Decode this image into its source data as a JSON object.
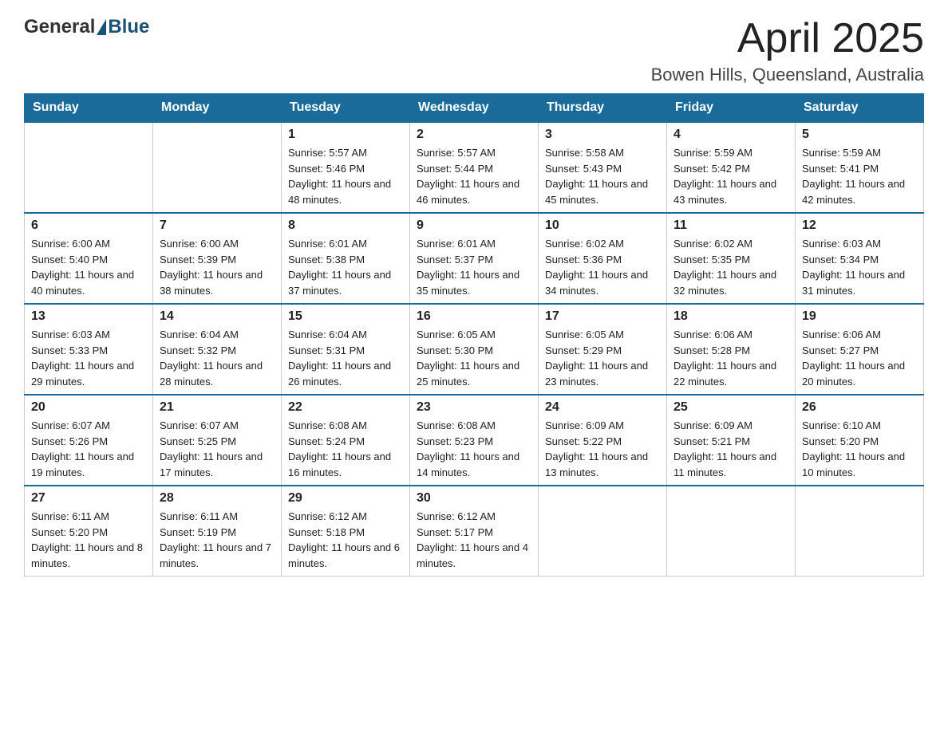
{
  "header": {
    "logo_general": "General",
    "logo_blue": "Blue",
    "month_title": "April 2025",
    "location": "Bowen Hills, Queensland, Australia"
  },
  "weekdays": [
    "Sunday",
    "Monday",
    "Tuesday",
    "Wednesday",
    "Thursday",
    "Friday",
    "Saturday"
  ],
  "weeks": [
    [
      {
        "day": "",
        "sunrise": "",
        "sunset": "",
        "daylight": ""
      },
      {
        "day": "",
        "sunrise": "",
        "sunset": "",
        "daylight": ""
      },
      {
        "day": "1",
        "sunrise": "Sunrise: 5:57 AM",
        "sunset": "Sunset: 5:46 PM",
        "daylight": "Daylight: 11 hours and 48 minutes."
      },
      {
        "day": "2",
        "sunrise": "Sunrise: 5:57 AM",
        "sunset": "Sunset: 5:44 PM",
        "daylight": "Daylight: 11 hours and 46 minutes."
      },
      {
        "day": "3",
        "sunrise": "Sunrise: 5:58 AM",
        "sunset": "Sunset: 5:43 PM",
        "daylight": "Daylight: 11 hours and 45 minutes."
      },
      {
        "day": "4",
        "sunrise": "Sunrise: 5:59 AM",
        "sunset": "Sunset: 5:42 PM",
        "daylight": "Daylight: 11 hours and 43 minutes."
      },
      {
        "day": "5",
        "sunrise": "Sunrise: 5:59 AM",
        "sunset": "Sunset: 5:41 PM",
        "daylight": "Daylight: 11 hours and 42 minutes."
      }
    ],
    [
      {
        "day": "6",
        "sunrise": "Sunrise: 6:00 AM",
        "sunset": "Sunset: 5:40 PM",
        "daylight": "Daylight: 11 hours and 40 minutes."
      },
      {
        "day": "7",
        "sunrise": "Sunrise: 6:00 AM",
        "sunset": "Sunset: 5:39 PM",
        "daylight": "Daylight: 11 hours and 38 minutes."
      },
      {
        "day": "8",
        "sunrise": "Sunrise: 6:01 AM",
        "sunset": "Sunset: 5:38 PM",
        "daylight": "Daylight: 11 hours and 37 minutes."
      },
      {
        "day": "9",
        "sunrise": "Sunrise: 6:01 AM",
        "sunset": "Sunset: 5:37 PM",
        "daylight": "Daylight: 11 hours and 35 minutes."
      },
      {
        "day": "10",
        "sunrise": "Sunrise: 6:02 AM",
        "sunset": "Sunset: 5:36 PM",
        "daylight": "Daylight: 11 hours and 34 minutes."
      },
      {
        "day": "11",
        "sunrise": "Sunrise: 6:02 AM",
        "sunset": "Sunset: 5:35 PM",
        "daylight": "Daylight: 11 hours and 32 minutes."
      },
      {
        "day": "12",
        "sunrise": "Sunrise: 6:03 AM",
        "sunset": "Sunset: 5:34 PM",
        "daylight": "Daylight: 11 hours and 31 minutes."
      }
    ],
    [
      {
        "day": "13",
        "sunrise": "Sunrise: 6:03 AM",
        "sunset": "Sunset: 5:33 PM",
        "daylight": "Daylight: 11 hours and 29 minutes."
      },
      {
        "day": "14",
        "sunrise": "Sunrise: 6:04 AM",
        "sunset": "Sunset: 5:32 PM",
        "daylight": "Daylight: 11 hours and 28 minutes."
      },
      {
        "day": "15",
        "sunrise": "Sunrise: 6:04 AM",
        "sunset": "Sunset: 5:31 PM",
        "daylight": "Daylight: 11 hours and 26 minutes."
      },
      {
        "day": "16",
        "sunrise": "Sunrise: 6:05 AM",
        "sunset": "Sunset: 5:30 PM",
        "daylight": "Daylight: 11 hours and 25 minutes."
      },
      {
        "day": "17",
        "sunrise": "Sunrise: 6:05 AM",
        "sunset": "Sunset: 5:29 PM",
        "daylight": "Daylight: 11 hours and 23 minutes."
      },
      {
        "day": "18",
        "sunrise": "Sunrise: 6:06 AM",
        "sunset": "Sunset: 5:28 PM",
        "daylight": "Daylight: 11 hours and 22 minutes."
      },
      {
        "day": "19",
        "sunrise": "Sunrise: 6:06 AM",
        "sunset": "Sunset: 5:27 PM",
        "daylight": "Daylight: 11 hours and 20 minutes."
      }
    ],
    [
      {
        "day": "20",
        "sunrise": "Sunrise: 6:07 AM",
        "sunset": "Sunset: 5:26 PM",
        "daylight": "Daylight: 11 hours and 19 minutes."
      },
      {
        "day": "21",
        "sunrise": "Sunrise: 6:07 AM",
        "sunset": "Sunset: 5:25 PM",
        "daylight": "Daylight: 11 hours and 17 minutes."
      },
      {
        "day": "22",
        "sunrise": "Sunrise: 6:08 AM",
        "sunset": "Sunset: 5:24 PM",
        "daylight": "Daylight: 11 hours and 16 minutes."
      },
      {
        "day": "23",
        "sunrise": "Sunrise: 6:08 AM",
        "sunset": "Sunset: 5:23 PM",
        "daylight": "Daylight: 11 hours and 14 minutes."
      },
      {
        "day": "24",
        "sunrise": "Sunrise: 6:09 AM",
        "sunset": "Sunset: 5:22 PM",
        "daylight": "Daylight: 11 hours and 13 minutes."
      },
      {
        "day": "25",
        "sunrise": "Sunrise: 6:09 AM",
        "sunset": "Sunset: 5:21 PM",
        "daylight": "Daylight: 11 hours and 11 minutes."
      },
      {
        "day": "26",
        "sunrise": "Sunrise: 6:10 AM",
        "sunset": "Sunset: 5:20 PM",
        "daylight": "Daylight: 11 hours and 10 minutes."
      }
    ],
    [
      {
        "day": "27",
        "sunrise": "Sunrise: 6:11 AM",
        "sunset": "Sunset: 5:20 PM",
        "daylight": "Daylight: 11 hours and 8 minutes."
      },
      {
        "day": "28",
        "sunrise": "Sunrise: 6:11 AM",
        "sunset": "Sunset: 5:19 PM",
        "daylight": "Daylight: 11 hours and 7 minutes."
      },
      {
        "day": "29",
        "sunrise": "Sunrise: 6:12 AM",
        "sunset": "Sunset: 5:18 PM",
        "daylight": "Daylight: 11 hours and 6 minutes."
      },
      {
        "day": "30",
        "sunrise": "Sunrise: 6:12 AM",
        "sunset": "Sunset: 5:17 PM",
        "daylight": "Daylight: 11 hours and 4 minutes."
      },
      {
        "day": "",
        "sunrise": "",
        "sunset": "",
        "daylight": ""
      },
      {
        "day": "",
        "sunrise": "",
        "sunset": "",
        "daylight": ""
      },
      {
        "day": "",
        "sunrise": "",
        "sunset": "",
        "daylight": ""
      }
    ]
  ]
}
